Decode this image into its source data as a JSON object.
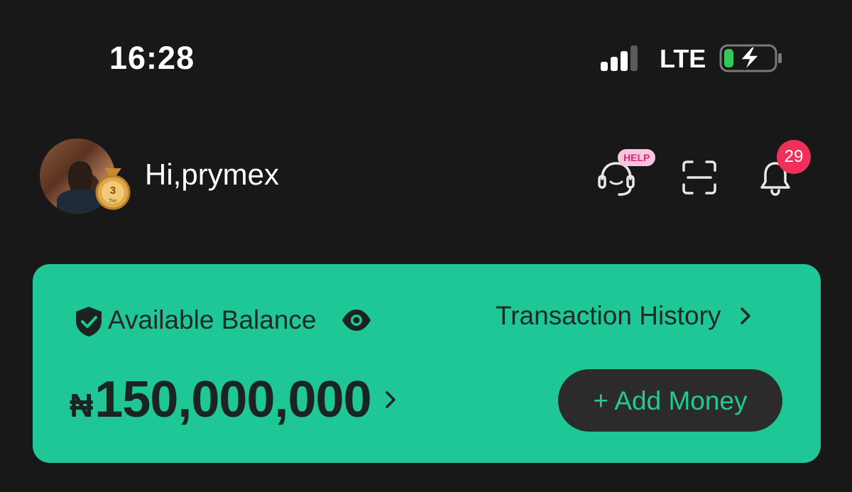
{
  "status_bar": {
    "time": "16:28",
    "network": "LTE",
    "signal_icon": "signal-bars-icon",
    "battery_icon": "battery-charging-icon"
  },
  "header": {
    "greeting": "Hi,prymex",
    "tier": {
      "number": "3",
      "label": "Tier"
    },
    "help_tag": "HELP",
    "notification_count": "29",
    "icons": [
      "headset-support-icon",
      "scan-icon",
      "bell-icon"
    ]
  },
  "balance_card": {
    "label": "Available Balance",
    "history_link": "Transaction History",
    "currency_symbol": "₦",
    "amount": "150,000,000",
    "add_money_label": "+ Add Money",
    "accent_color": "#1ec795"
  }
}
